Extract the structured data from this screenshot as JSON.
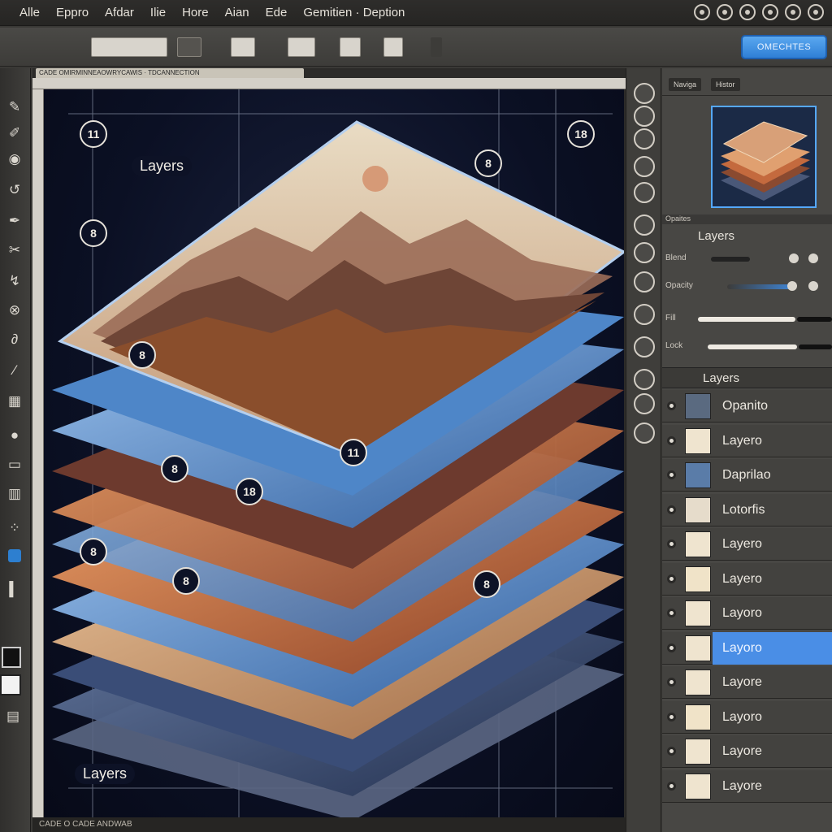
{
  "menu": {
    "items": [
      "Alle",
      "Eppro",
      "Afdar",
      "Ilie",
      "Hore",
      "Aian",
      "Ede",
      "Gemitien · Deption"
    ]
  },
  "options": {
    "action_label": "OMECHTES"
  },
  "document": {
    "tab_title": "CADE OMIRMINNEAOWRYCAWIS · TDCANNECTION",
    "status_text": "CADE O CADE ANDWAB"
  },
  "canvas": {
    "labels": {
      "top": "Layers",
      "bottom": "Layers"
    },
    "callouts": [
      "11",
      "8",
      "18",
      "8",
      "8",
      "11",
      "8",
      "18",
      "8",
      "8",
      "8"
    ]
  },
  "right_panel": {
    "nav_tabs": [
      "Naviga",
      "Histor"
    ],
    "layers_header": "Opaites",
    "panel_title": "Layers",
    "sliders": [
      {
        "label": "Blend"
      },
      {
        "label": "Opacity",
        "value": 0.62
      },
      {
        "label": "Fill",
        "value": 0.82
      },
      {
        "label": "Lock",
        "value": 0.9
      }
    ],
    "list_header": "Layers",
    "layers": [
      {
        "name": "Opanito",
        "thumb": "#5a6a80",
        "selected": false
      },
      {
        "name": "Layero",
        "thumb": "#efe4cf",
        "selected": false
      },
      {
        "name": "Daprilao",
        "thumb": "#5a7ca8",
        "selected": false
      },
      {
        "name": "Lotorfis",
        "thumb": "#e6dccb",
        "selected": false
      },
      {
        "name": "Layero",
        "thumb": "#efe4cf",
        "selected": false
      },
      {
        "name": "Layero",
        "thumb": "#f0e3c8",
        "selected": false
      },
      {
        "name": "Layoro",
        "thumb": "#efe4cf",
        "selected": false
      },
      {
        "name": "Layoro",
        "thumb": "#efe4cf",
        "selected": true
      },
      {
        "name": "Layore",
        "thumb": "#efe4cf",
        "selected": false
      },
      {
        "name": "Layoro",
        "thumb": "#f0e3c8",
        "selected": false
      },
      {
        "name": "Layore",
        "thumb": "#efe4cf",
        "selected": false
      },
      {
        "name": "Layore",
        "thumb": "#efe4cf",
        "selected": false
      }
    ]
  }
}
